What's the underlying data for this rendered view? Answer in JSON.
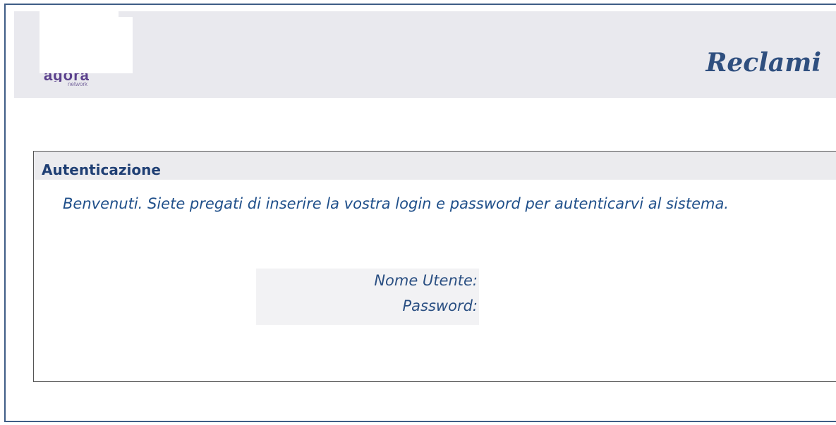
{
  "header": {
    "logo": {
      "name": "agora-network-logo",
      "wordmark": "agora",
      "subtitle": "network"
    },
    "title": "Reclami"
  },
  "auth_panel": {
    "title": "Autenticazione",
    "welcome_text": "Benvenuti. Siete pregati di inserire la vostra login e password per autenticarvi al sistema.",
    "fields": {
      "username_label": "Nome Utente:",
      "password_label": "Password:"
    }
  },
  "colors": {
    "frame_border": "#3f5d86",
    "header_bg": "#e9e9ee",
    "title_text": "#2f4f7f",
    "panel_title": "#1f3f74",
    "body_text": "#1f4f8a"
  }
}
